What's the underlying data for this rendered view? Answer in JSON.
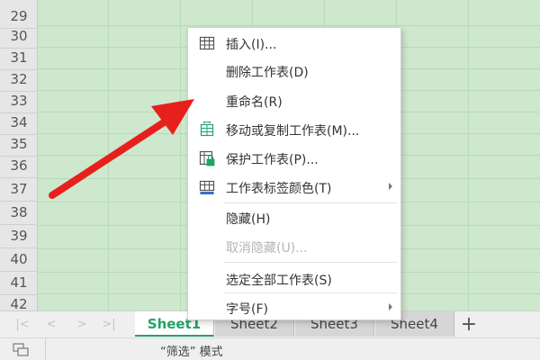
{
  "row_numbers": [
    "29",
    "30",
    "31",
    "32",
    "33",
    "34",
    "35",
    "36",
    "37",
    "38",
    "39",
    "40",
    "41",
    "42"
  ],
  "context_menu": {
    "items": [
      {
        "label": "插入(I)...",
        "icon": "insert-table-icon"
      },
      {
        "label": "删除工作表(D)"
      },
      {
        "label": "重命名(R)"
      },
      {
        "label": "移动或复制工作表(M)...",
        "icon": "move-copy-sheet-icon"
      },
      {
        "label": "保护工作表(P)...",
        "icon": "protect-sheet-lock-icon"
      },
      {
        "label": "工作表标签颜色(T)",
        "icon": "tab-color-icon",
        "has_submenu": true
      },
      {
        "label": "隐藏(H)"
      },
      {
        "label": "取消隐藏(U)...",
        "disabled": true
      },
      {
        "label": "选定全部工作表(S)"
      },
      {
        "label": "字号(F)",
        "has_submenu": true
      }
    ]
  },
  "sheet_tabs": [
    {
      "label": "Sheet1",
      "active": true
    },
    {
      "label": "Sheet2"
    },
    {
      "label": "Sheet3"
    },
    {
      "label": "Sheet4"
    }
  ],
  "add_sheet_symbol": "+",
  "nav_arrows": [
    "|<",
    "<",
    ">",
    ">|"
  ],
  "status_bar": {
    "text": "“筛选” 模式",
    "icon": "sheet-view-icon"
  },
  "colors": {
    "grid_background": "#cde8cd",
    "active_tab_text": "#21a366",
    "arrow": "#e8201c"
  }
}
